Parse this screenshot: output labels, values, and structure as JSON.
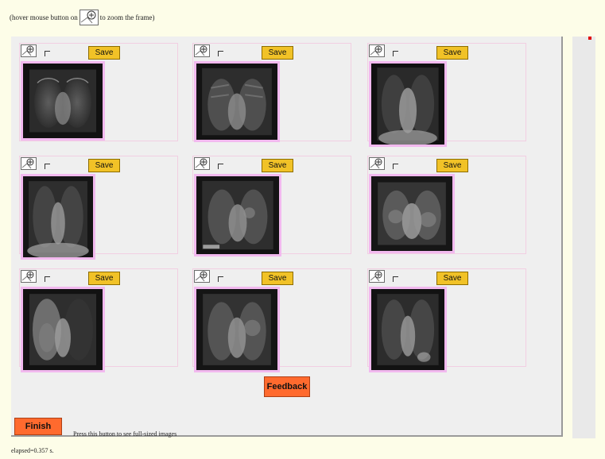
{
  "hint": {
    "prefix": "(hover mouse button on",
    "suffix": "to zoom the frame)"
  },
  "buttons": {
    "save_label": "Save",
    "feedback_label": "Feedback",
    "finish_label": "Finish"
  },
  "finish_note": "Press this button to see full-sized images",
  "elapsed": "elapsed=0.357 s.",
  "icons": {
    "zoom": "zoom-icon",
    "checkbox": "checkbox-icon"
  },
  "images": [
    {
      "checked": false
    },
    {
      "checked": false
    },
    {
      "checked": false
    },
    {
      "checked": false
    },
    {
      "checked": false
    },
    {
      "checked": false
    },
    {
      "checked": false
    },
    {
      "checked": false
    },
    {
      "checked": false
    }
  ]
}
